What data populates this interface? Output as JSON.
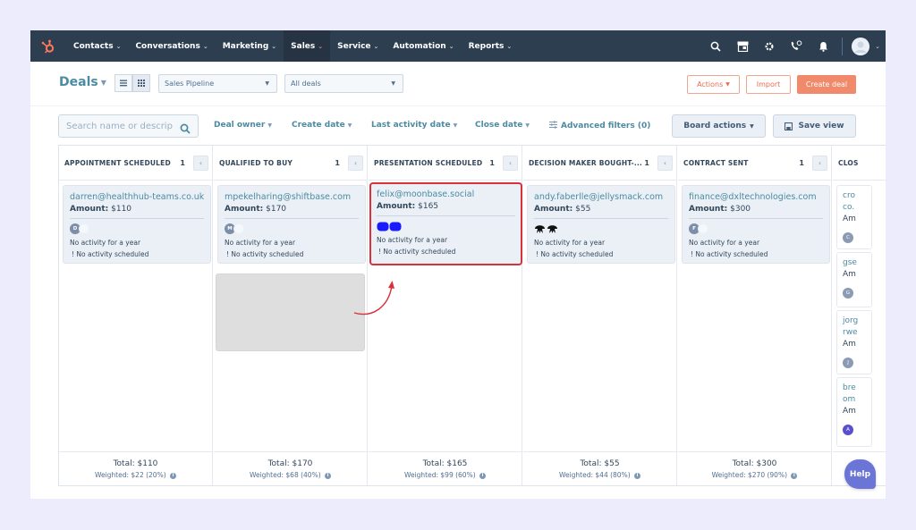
{
  "nav": {
    "logo": "hubspot-logo",
    "items": [
      {
        "label": "Contacts",
        "active": false
      },
      {
        "label": "Conversations",
        "active": false
      },
      {
        "label": "Marketing",
        "active": false
      },
      {
        "label": "Sales",
        "active": true
      },
      {
        "label": "Service",
        "active": false
      },
      {
        "label": "Automation",
        "active": false
      },
      {
        "label": "Reports",
        "active": false
      }
    ],
    "right_icons": [
      "search-icon",
      "marketplace-icon",
      "gear-icon",
      "calling-icon",
      "bell-icon"
    ]
  },
  "header": {
    "title": "Deals",
    "view_modes": [
      "list-view",
      "board-view"
    ],
    "active_view": "board-view",
    "pipeline_select": "Sales Pipeline",
    "deals_select": "All deals",
    "actions_label": "Actions",
    "import_label": "Import",
    "create_label": "Create deal"
  },
  "filters": {
    "search_placeholder": "Search name or descrip",
    "deal_owner": "Deal owner",
    "create_date": "Create date",
    "last_activity_date": "Last activity date",
    "close_date": "Close date",
    "advanced_filters": "Advanced filters (0)",
    "board_actions": "Board actions",
    "save_view": "Save view"
  },
  "columns": [
    {
      "title": "APPOINTMENT SCHEDULED",
      "count": "1",
      "card": {
        "name": "darren@healthhub-teams.co.uk",
        "amount_label": "Amount:",
        "amount": "$110",
        "avatar": "D",
        "activity": "No activity for a year",
        "scheduled": "! No activity scheduled"
      },
      "total": "Total: $110",
      "weighted": "Weighted: $22 (20%)"
    },
    {
      "title": "QUALIFIED TO BUY",
      "count": "1",
      "card": {
        "name": "mpekelharing@shiftbase.com",
        "amount_label": "Amount:",
        "amount": "$170",
        "avatar": "M",
        "activity": "No activity for a year",
        "scheduled": "! No activity scheduled"
      },
      "total": "Total: $170",
      "weighted": "Weighted: $68 (40%)"
    },
    {
      "title": "PRESENTATION SCHEDULED",
      "count": "1",
      "card": {
        "name": "felix@moonbase.social",
        "amount_label": "Amount:",
        "amount": "$165",
        "avatar": "",
        "activity": "No activity for a year",
        "scheduled": "! No activity scheduled"
      },
      "total": "Total: $165",
      "weighted": "Weighted: $99 (60%)"
    },
    {
      "title": "DECISION MAKER BOUGHT-...",
      "count": "1",
      "card": {
        "name": "andy.faberlle@jellysmack.com",
        "amount_label": "Amount:",
        "amount": "$55",
        "avatar": "",
        "activity": "No activity for a year",
        "scheduled": "! No activity scheduled"
      },
      "total": "Total: $55",
      "weighted": "Weighted: $44 (80%)"
    },
    {
      "title": "CONTRACT SENT",
      "count": "1",
      "card": {
        "name": "finance@dxltechnologies.com",
        "amount_label": "Amount:",
        "amount": "$300",
        "avatar": "F",
        "activity": "No activity for a year",
        "scheduled": "! No activity scheduled"
      },
      "total": "Total: $300",
      "weighted": "Weighted: $270 (90%)"
    }
  ],
  "partial_column": {
    "title": "CLOS",
    "cards": [
      {
        "name_line1": "cro",
        "name_line2": "co.",
        "amount": "Am",
        "avatar": "C"
      },
      {
        "name_line1": "gse",
        "name_line2": "",
        "amount": "Am",
        "avatar": "G"
      },
      {
        "name_line1": "jorg",
        "name_line2": "rwe",
        "amount": "Am",
        "avatar": "J"
      },
      {
        "name_line1": "bre",
        "name_line2": "om",
        "amount": "Am",
        "avatar": "A"
      }
    ]
  },
  "colors": {
    "nav_bg": "#2d3e50",
    "accent_link": "#4b8ba3",
    "primary_button": "#f08a6b",
    "highlight_border": "#d9303b",
    "help_button": "#6a75d6"
  },
  "help_label": "Help"
}
